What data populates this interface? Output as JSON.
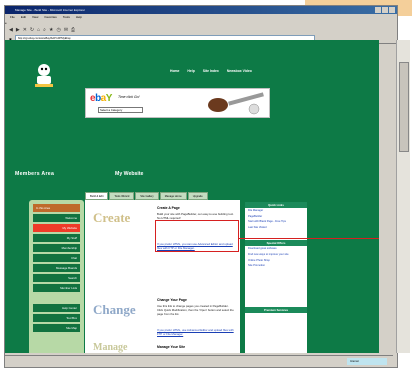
{
  "window": {
    "title": "Manage Site - Build Site - Microsoft Internet Explorer"
  },
  "menubar": [
    "File",
    "Edit",
    "View",
    "Favorites",
    "Tools",
    "Help"
  ],
  "address": {
    "value": "http://cgi.ebay.com/ws/eBayISAPI.dll?MyEbay"
  },
  "topnav": [
    "Home",
    "Help",
    "Site Index",
    "Newsbox Video"
  ],
  "banner": {
    "slogan": "Time click Go!",
    "select": "Select a Category"
  },
  "section": {
    "title": "Members Area",
    "subtitle": "My Website"
  },
  "sidebar": [
    {
      "label": "In this Area",
      "type": "header"
    },
    {
      "label": "Welcome",
      "type": "normal"
    },
    {
      "label": "My Website",
      "type": "active"
    },
    {
      "label": "My Stuff",
      "type": "normal"
    },
    {
      "label": "Membership",
      "type": "normal"
    },
    {
      "label": "Chat",
      "type": "normal"
    },
    {
      "label": "Message Boards",
      "type": "normal"
    },
    {
      "label": "Search",
      "type": "normal"
    },
    {
      "label": "Member Lists",
      "type": "normal"
    },
    {
      "label": "Help Center",
      "type": "normal"
    },
    {
      "label": "Tool Box",
      "type": "normal"
    },
    {
      "label": "Site Map",
      "type": "normal"
    }
  ],
  "tabs": [
    "Build & Edit",
    "Tools Wizard",
    "Site Gallery",
    "Manage Home",
    "Upgrade"
  ],
  "content": {
    "create_word": "Create",
    "create_title": "Create A Page",
    "create_text": "Build your site with PageBuilder, our easy-to-use building tool. No HTML required!",
    "create_text2": "If you prefer HTML, you can use Advanced Editor and upload files with FTP or File Manager.",
    "change_word": "Change",
    "change_title": "Change Your Page",
    "change_text": "Use this link to change pages you created in PageBuilder. Click Quick Modification, then the 'Open' button and select the page from the list.",
    "change_text2": "If you prefer HTML, use Advanced Editor and upload files with FTP or File Manager.",
    "manage_word": "Manage",
    "manage_title": "Manage Your Site"
  },
  "rightcol": {
    "quick_title": "Quick Links",
    "quick_links": [
      "File Manager",
      "PageBuilder",
      "Start with Blank Page - Free Tips",
      "Last Site Visited"
    ],
    "special_title": "Special Offers",
    "special_links": [
      "Download great software",
      "Find new ways to improve your site",
      "Online Photo Shop",
      "Site Promotion"
    ],
    "services_title": "Premium Services"
  },
  "status": {
    "zone": "Internet"
  }
}
